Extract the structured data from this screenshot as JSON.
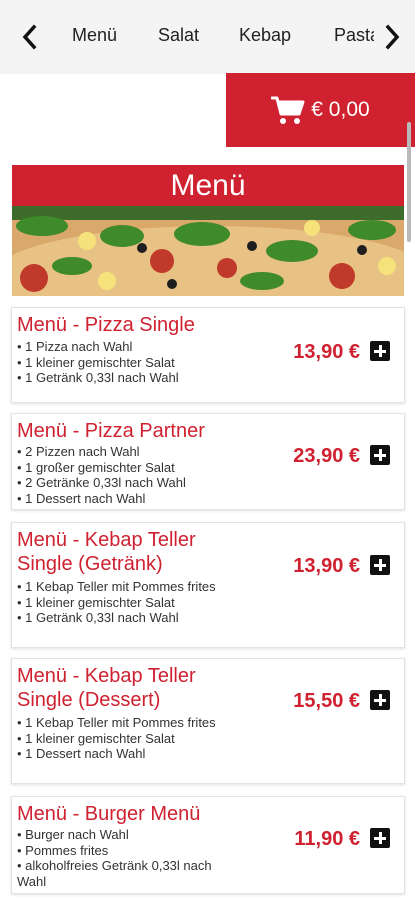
{
  "nav": {
    "tabs": [
      {
        "label": "Menü"
      },
      {
        "label": "Salat"
      },
      {
        "label": "Kebap"
      },
      {
        "label": "Pasta"
      }
    ]
  },
  "cart": {
    "total": "€ 0,00"
  },
  "section": {
    "title": "Menü"
  },
  "menu_items": [
    {
      "title": "Menü - Pizza Single",
      "items": [
        "• 1 Pizza nach Wahl",
        "• 1 kleiner gemischter Salat",
        "• 1 Getränk 0,33l nach Wahl"
      ],
      "price": "13,90 €"
    },
    {
      "title": "Menü - Pizza Partner",
      "items": [
        "• 2 Pizzen nach Wahl",
        "• 1 großer gemischter Salat",
        "• 2 Getränke 0,33l nach Wahl",
        "• 1 Dessert nach Wahl"
      ],
      "price": "23,90 €"
    },
    {
      "title": "Menü - Kebap Teller Single (Getränk)",
      "items": [
        "• 1 Kebap Teller mit Pommes frites",
        "• 1 kleiner gemischter Salat",
        "• 1 Getränk 0,33l nach Wahl"
      ],
      "price": "13,90 €"
    },
    {
      "title": "Menü - Kebap Teller Single (Dessert)",
      "items": [
        "• 1 Kebap Teller mit Pommes frites",
        "• 1 kleiner gemischter Salat",
        "• 1 Dessert nach Wahl"
      ],
      "price": "15,50 €"
    },
    {
      "title": "Menü - Burger Menü",
      "items": [
        "• Burger nach Wahl",
        "• Pommes frites",
        "• alkoholfreies Getränk 0,33l nach Wahl"
      ],
      "price": "11,90 €"
    }
  ],
  "colors": {
    "accent": "#cf2130",
    "nav_bg": "#f4f4f4"
  },
  "icons": {
    "nav_prev": "chevron-left-icon",
    "nav_next": "chevron-right-icon",
    "cart": "shopping-cart-icon",
    "add": "plus-icon"
  }
}
